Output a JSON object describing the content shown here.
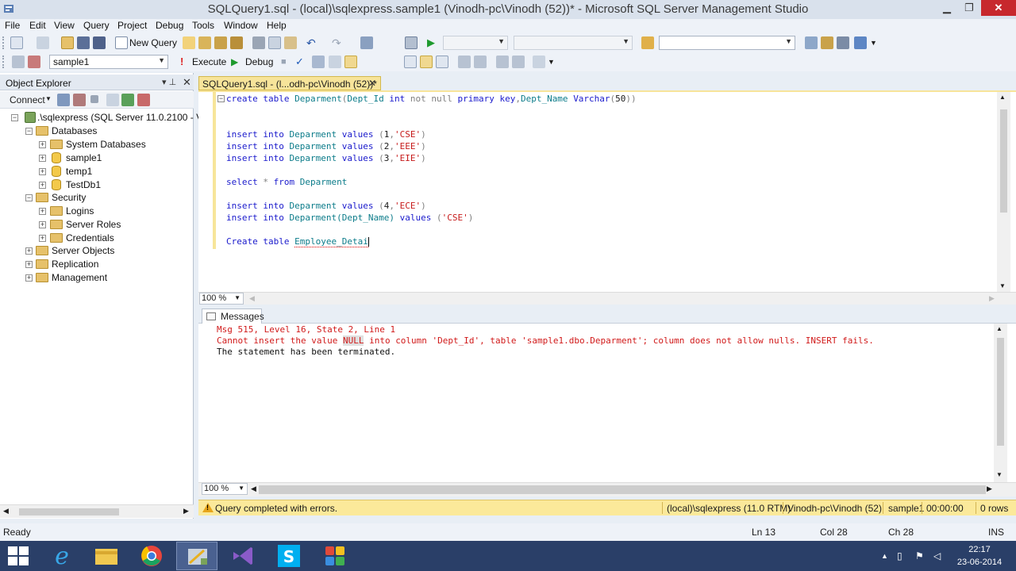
{
  "window": {
    "title": "SQLQuery1.sql - (local)\\sqlexpress.sample1 (Vinodh-pc\\Vinodh (52))* - Microsoft SQL Server Management Studio",
    "min": "▁",
    "max": "❐",
    "close": "✕"
  },
  "menu": [
    "File",
    "Edit",
    "View",
    "Query",
    "Project",
    "Debug",
    "Tools",
    "Window",
    "Help"
  ],
  "toolbar": {
    "new_query": "New Query",
    "database": "sample1",
    "execute": "Execute",
    "debug": "Debug"
  },
  "object_explorer": {
    "title": "Object Explorer",
    "connect": "Connect",
    "pin": "▾ ⊥",
    "tree": {
      "server": ".\\sqlexpress (SQL Server 11.0.2100 - Vinc",
      "databases": "Databases",
      "system_databases": "System Databases",
      "db_sample1": "sample1",
      "db_temp1": "temp1",
      "db_testdb1": "TestDb1",
      "security": "Security",
      "logins": "Logins",
      "server_roles": "Server Roles",
      "credentials": "Credentials",
      "server_objects": "Server Objects",
      "replication": "Replication",
      "management": "Management"
    }
  },
  "editor": {
    "tab_label": "SQLQuery1.sql - (l...odh-pc\\Vinodh (52))*",
    "zoom": "100 %",
    "code": {
      "l1": [
        "create",
        "table",
        "Deparment",
        "Dept_Id",
        "int",
        "not",
        "null",
        "primary",
        "key",
        "Dept_Name",
        "Varchar",
        "50"
      ],
      "ins": [
        "insert",
        "into",
        "Deparment",
        "values"
      ],
      "v1": "'CSE'",
      "v2": "'EEE'",
      "v3": "'EIE'",
      "v4": "'ECE'",
      "sel": [
        "select",
        "*",
        "from",
        "Deparment"
      ],
      "ins5_table": "Deparment(Dept_Name)",
      "v5": "'CSE'",
      "last": [
        "Create",
        "table",
        "Employee_Detai"
      ]
    }
  },
  "results": {
    "tab_label": "Messages",
    "line1": "Msg 515, Level 16, State 2, Line 1",
    "line2_a": "Cannot insert the value ",
    "line2_null": "NULL",
    "line2_b": " into column 'Dept_Id', table 'sample1.dbo.Deparment'; column does not allow nulls. INSERT fails.",
    "line3": "The statement has been terminated.",
    "zoom": "100 %"
  },
  "query_status": {
    "message": "Query completed with errors.",
    "server": "(local)\\sqlexpress (11.0 RTM)",
    "user": "Vinodh-pc\\Vinodh (52)",
    "database": "sample1",
    "elapsed": "00:00:00",
    "rows": "0 rows"
  },
  "status_bar": {
    "state": "Ready",
    "ln": "Ln 13",
    "col": "Col 28",
    "ch": "Ch 28",
    "ins": "INS"
  },
  "taskbar": {
    "time": "22:17",
    "date": "23-06-2014",
    "apps": [
      "internet-explorer",
      "file-explorer",
      "chrome",
      "ssms",
      "visual-studio",
      "skype",
      "app-tiles"
    ]
  },
  "colors": {
    "keyword": "#1a1acc",
    "string": "#c61a1a",
    "error": "#d11a1a",
    "status_yellow": "#fbe99a",
    "taskbar": "#2a3f68"
  }
}
